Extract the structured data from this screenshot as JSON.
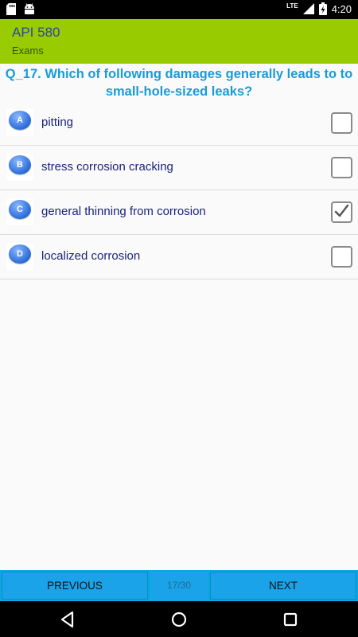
{
  "status_bar": {
    "time": "4:20",
    "network": "LTE",
    "icons": [
      "sd-card-icon",
      "android-icon",
      "signal-icon",
      "battery-icon"
    ]
  },
  "app_bar": {
    "title": "API 580",
    "subtitle": "Exams",
    "background": "#99cc00"
  },
  "question": {
    "text": "Q_17. Which of following damages generally leads to to small-hole-sized leaks?",
    "color": "#1a9bd7"
  },
  "options": [
    {
      "letter": "A",
      "text": "pitting",
      "checked": false
    },
    {
      "letter": "B",
      "text": "stress corrosion cracking",
      "checked": false
    },
    {
      "letter": "C",
      "text": "general thinning from corrosion",
      "checked": true
    },
    {
      "letter": "D",
      "text": "localized corrosion",
      "checked": false
    }
  ],
  "navigation": {
    "previous_label": "PREVIOUS",
    "next_label": "NEXT",
    "counter": "17/30",
    "accent": "#1aa3e8"
  },
  "system_nav": {
    "icons": [
      "back-icon",
      "home-icon",
      "recents-icon"
    ]
  }
}
